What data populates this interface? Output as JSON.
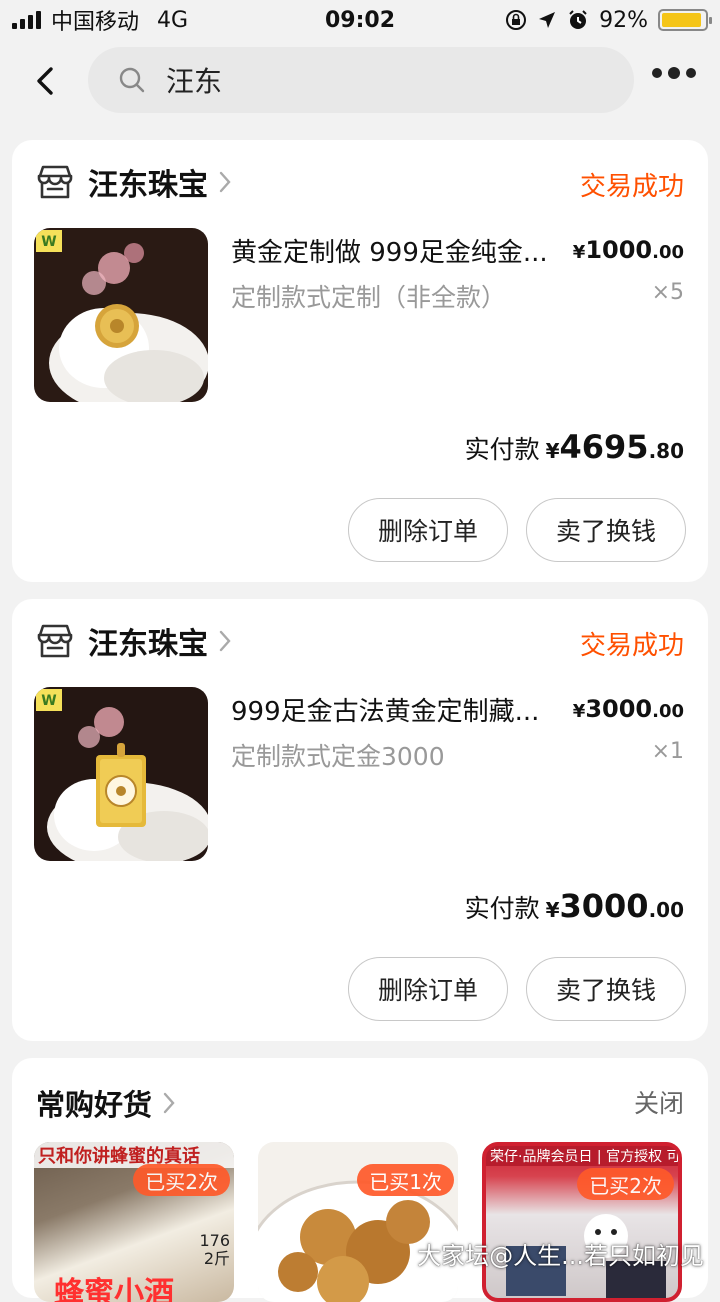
{
  "status_bar": {
    "carrier": "中国移动",
    "network": "4G",
    "time": "09:02",
    "battery": "92%",
    "battery_level": 0.92
  },
  "search": {
    "query": "汪东"
  },
  "orders": [
    {
      "shop_name": "汪东珠宝",
      "status": "交易成功",
      "title": "黄金定制做 999足金纯金...",
      "subtitle": "定制款式定制（非全款）",
      "price_currency": "¥",
      "price_int": "1000",
      "price_dec": ".00",
      "quantity": "×5",
      "paid_label": "实付款",
      "paid_currency": "¥",
      "paid_int": "4695",
      "paid_dec": ".80",
      "delete_label": "删除订单",
      "sell_label": "卖了换钱"
    },
    {
      "shop_name": "汪东珠宝",
      "status": "交易成功",
      "title": "999足金古法黄金定制藏...",
      "subtitle": "定制款式定金3000",
      "price_currency": "¥",
      "price_int": "3000",
      "price_dec": ".00",
      "quantity": "×1",
      "paid_label": "实付款",
      "paid_currency": "¥",
      "paid_int": "3000",
      "paid_dec": ".00",
      "delete_label": "删除订单",
      "sell_label": "卖了换钱"
    }
  ],
  "recommend": {
    "title": "常购好货",
    "close_label": "关闭",
    "items": [
      {
        "badge": "已买2次",
        "banner": "只和你讲蜂蜜的真话",
        "bottom_text": "蜂蜜小酒",
        "side_text_1": "176",
        "side_text_2": "2斤"
      },
      {
        "badge": "已买1次"
      },
      {
        "badge": "已买2次",
        "banner": "荣仔·品牌会员日 | 官方授权 可查防伪"
      }
    ]
  },
  "watermark": "大家坛@人生...若只如初见",
  "colors": {
    "accent": "#ff5000",
    "badge": "#ff5a2a",
    "gold": "#e5b93a"
  }
}
